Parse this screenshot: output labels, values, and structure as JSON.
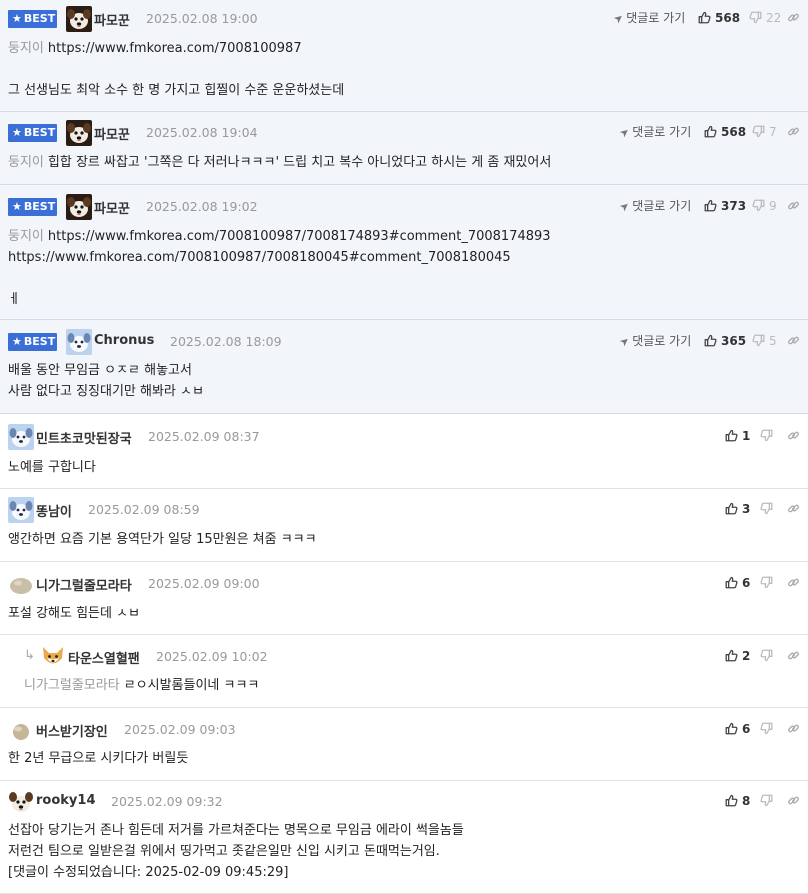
{
  "best_label": "BEST",
  "reply_label": "댓글로 가기",
  "comments": [
    {
      "best": true,
      "avatar": "dog",
      "nick": "파모꾼",
      "date": "2025.02.08 19:00",
      "likes": "568",
      "dislikes": "22",
      "mention": "둥지이",
      "lines": [
        "https://www.fmkorea.com/7008100987",
        "",
        "그 선생님도 최악 소수 한 명 가지고 힙찔이 수준 운운하셨는데"
      ]
    },
    {
      "best": true,
      "avatar": "dog",
      "nick": "파모꾼",
      "date": "2025.02.08 19:04",
      "likes": "568",
      "dislikes": "7",
      "mention": "둥지이",
      "lines": [
        "힙합 장르 싸잡고 '그쪽은 다 저러나ㅋㅋㅋ' 드립 치고 복수 아니었다고 하시는 게 좀 재밌어서"
      ]
    },
    {
      "best": true,
      "avatar": "dog",
      "nick": "파모꾼",
      "date": "2025.02.08 19:02",
      "likes": "373",
      "dislikes": "9",
      "mention": "둥지이",
      "lines": [
        "https://www.fmkorea.com/7008100987/7008174893#comment_7008174893",
        "https://www.fmkorea.com/7008100987/7008180045#comment_7008180045",
        "",
        "ㅔ"
      ]
    },
    {
      "best": true,
      "avatar": "bluedog",
      "nick": "Chronus",
      "date": "2025.02.08 18:09",
      "likes": "365",
      "dislikes": "5",
      "mention": "",
      "lines": [
        "배울 동안 무임금 ㅇㅈㄹ 해놓고서",
        "사람 없다고 징징대기만 해봐라 ㅅㅂ"
      ]
    },
    {
      "best": false,
      "avatar": "bluedog",
      "nick": "민트초코맛된장국",
      "date": "2025.02.09 08:37",
      "likes": "1",
      "mention": "",
      "lines": [
        "노예를 구합니다"
      ]
    },
    {
      "best": false,
      "avatar": "bluedog",
      "nick": "똥남이",
      "date": "2025.02.09 08:59",
      "likes": "3",
      "mention": "",
      "lines": [
        "앵간하면 요즘 기본 용역단가 일당 15만원은 쳐줌 ㅋㅋㅋ"
      ]
    },
    {
      "best": false,
      "avatar": "stone",
      "nick": "니가그럴줄모라타",
      "date": "2025.02.09 09:00",
      "likes": "6",
      "mention": "",
      "lines": [
        "포설 강해도 힘든데 ㅅㅂ"
      ]
    },
    {
      "best": false,
      "reply": true,
      "avatar": "fox",
      "nick": "타운스열혈팬",
      "date": "2025.02.09 10:02",
      "likes": "2",
      "mention": "니가그럴줄모라타",
      "lines": [
        "ㄹㅇ시발롬들이네 ㅋㅋㅋ"
      ]
    },
    {
      "best": false,
      "avatar": "stone2",
      "nick": "버스받기장인",
      "date": "2025.02.09 09:03",
      "likes": "6",
      "mention": "",
      "lines": [
        "한 2년 무급으로 시키다가 버릴듯"
      ]
    },
    {
      "best": false,
      "avatar": "dog2",
      "nick": "rooky14",
      "date": "2025.02.09 09:32",
      "likes": "8",
      "mention": "",
      "lines": [
        "선잡아 당기는거 존나 힘든데 저거를 가르쳐준다는 명목으로 무임금 에라이 썩을놈들",
        "저런건 팀으로 일받은걸 위에서 띵가먹고 좃같은일만 신입 시키고 돈때먹는거임.",
        "[댓글이 수정되었습니다: 2025-02-09 09:45:29]"
      ]
    }
  ]
}
